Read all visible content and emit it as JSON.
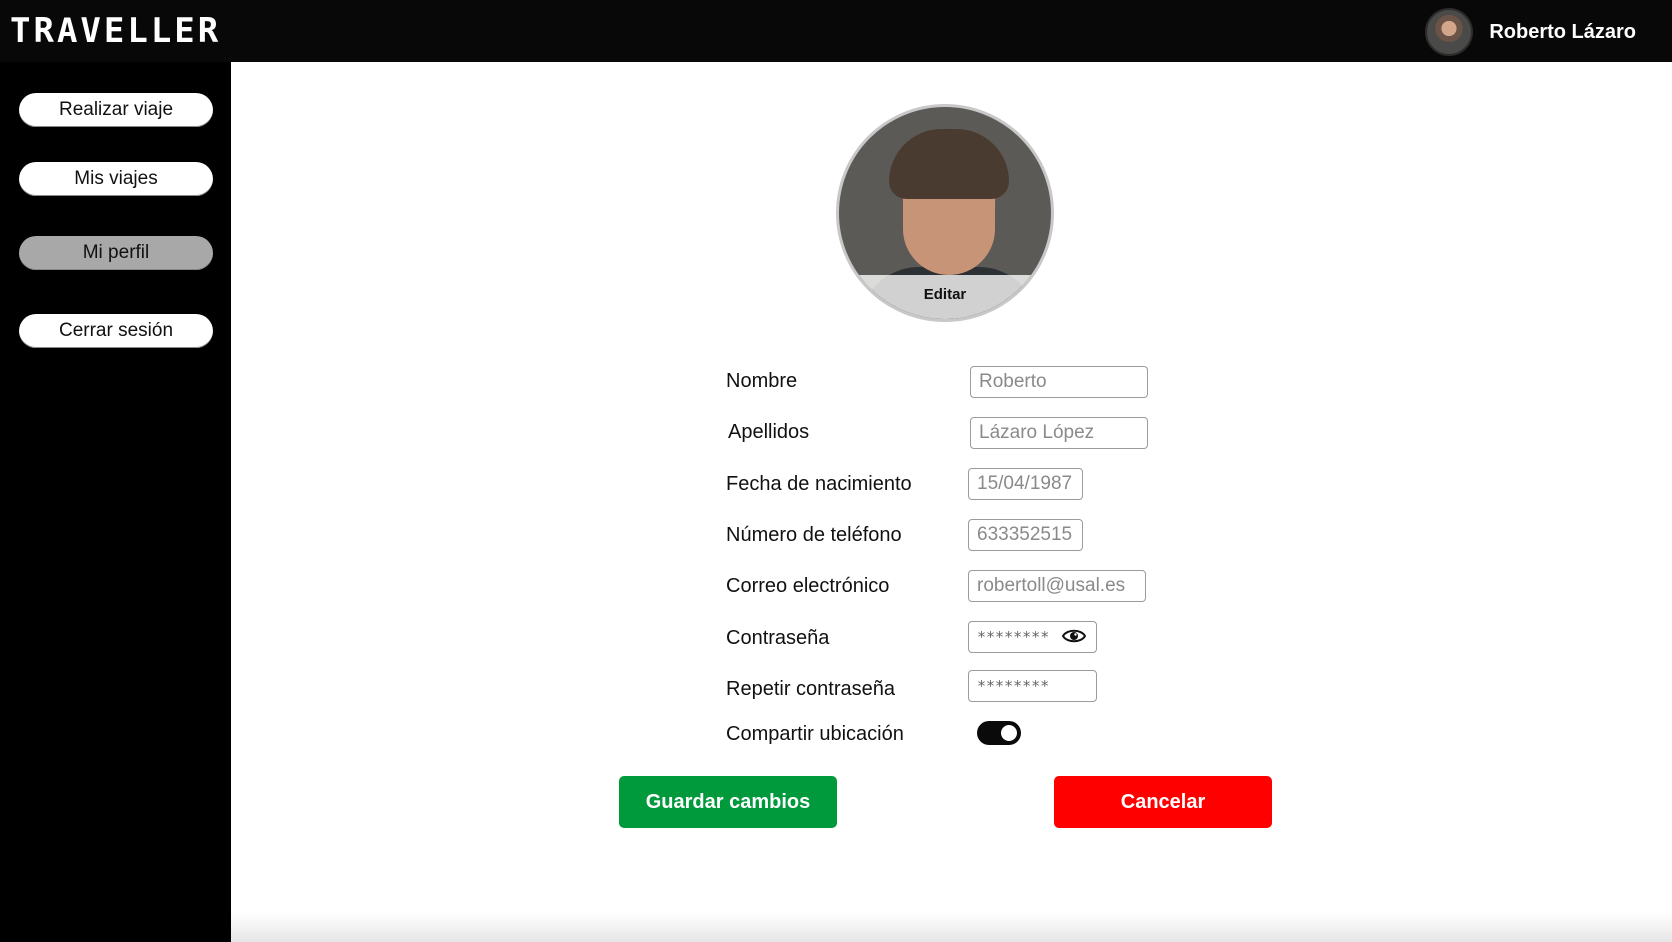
{
  "header": {
    "logo": "TRAVELLER",
    "user_name": "Roberto Lázaro",
    "bar_color": "#080808"
  },
  "sidebar": {
    "items": [
      {
        "label": "Realizar viaje",
        "active": false
      },
      {
        "label": "Mis viajes",
        "active": false
      },
      {
        "label": "Mi perfil",
        "active": true
      },
      {
        "label": "Cerrar sesión",
        "active": false
      }
    ]
  },
  "profile": {
    "edit_label": "Editar",
    "fields": [
      {
        "label": "Nombre",
        "value": "Roberto"
      },
      {
        "label": "Apellidos",
        "value": "Lázaro López"
      },
      {
        "label": "Fecha de nacimiento",
        "value": "15/04/1987"
      },
      {
        "label": "Número de teléfono",
        "value": "633352515"
      },
      {
        "label": "Correo electrónico",
        "value": "robertoll@usal.es"
      },
      {
        "label": "Contraseña",
        "value": "********"
      },
      {
        "label": "Repetir contraseña",
        "value": "********"
      }
    ],
    "share_location": {
      "label": "Compartir ubicación",
      "enabled": true
    }
  },
  "actions": {
    "save_label": "Guardar cambios",
    "save_color": "#009a3c",
    "cancel_label": "Cancelar",
    "cancel_color": "#ff0000"
  },
  "icons": [
    "eye-icon"
  ]
}
